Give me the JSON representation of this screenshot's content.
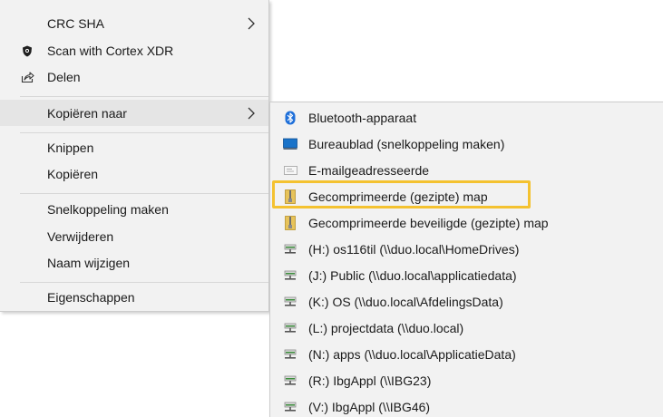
{
  "context_menu": {
    "items": [
      {
        "label": "CRC SHA",
        "icon": "",
        "submenu": true
      },
      {
        "label": "Scan with Cortex XDR",
        "icon": "shield-icon",
        "submenu": false
      },
      {
        "label": "Delen",
        "icon": "share-icon",
        "submenu": false
      },
      {
        "label": "Kopiëren naar",
        "icon": "",
        "submenu": true
      },
      {
        "label": "Knippen",
        "icon": "",
        "submenu": false
      },
      {
        "label": "Kopiëren",
        "icon": "",
        "submenu": false
      },
      {
        "label": "Snelkoppeling maken",
        "icon": "",
        "submenu": false
      },
      {
        "label": "Verwijderen",
        "icon": "",
        "submenu": false
      },
      {
        "label": "Naam wijzigen",
        "icon": "",
        "submenu": false
      },
      {
        "label": "Eigenschappen",
        "icon": "",
        "submenu": false
      }
    ],
    "hovered_item": "Kopiëren naar"
  },
  "submenu": {
    "items": [
      {
        "label": "Bluetooth-apparaat",
        "icon": "bluetooth-icon"
      },
      {
        "label": "Bureaublad (snelkoppeling maken)",
        "icon": "desktop-icon"
      },
      {
        "label": "E-mailgeadresseerde",
        "icon": "mail-icon"
      },
      {
        "label": "Gecomprimeerde (gezipte) map",
        "icon": "zip-folder-icon"
      },
      {
        "label": "Gecomprimeerde beveiligde (gezipte) map",
        "icon": "zip-folder-icon"
      },
      {
        "label": "(H:) os116til (\\\\duo.local\\HomeDrives)",
        "icon": "network-drive-icon"
      },
      {
        "label": "(J:) Public (\\\\duo.local\\applicatiedata)",
        "icon": "network-drive-icon"
      },
      {
        "label": "(K:) OS (\\\\duo.local\\AfdelingsData)",
        "icon": "network-drive-icon"
      },
      {
        "label": "(L:) projectdata (\\\\duo.local)",
        "icon": "network-drive-icon"
      },
      {
        "label": "(N:) apps (\\\\duo.local\\ApplicatieData)",
        "icon": "network-drive-icon"
      },
      {
        "label": "(R:) IbgAppl (\\\\IBG23)",
        "icon": "network-drive-icon"
      },
      {
        "label": "(V:) IbgAppl (\\\\IBG46)",
        "icon": "network-drive-icon"
      }
    ],
    "highlighted_item": "Gecomprimeerde (gezipte) map"
  },
  "colors": {
    "menu_bg": "#f2f2f2",
    "hover_bg": "#e5e5e5",
    "highlight_border": "#f4c230",
    "bluetooth_blue": "#1e6fd9",
    "desktop_blue": "#1a73c9",
    "drive_green": "#3c8d3c"
  }
}
